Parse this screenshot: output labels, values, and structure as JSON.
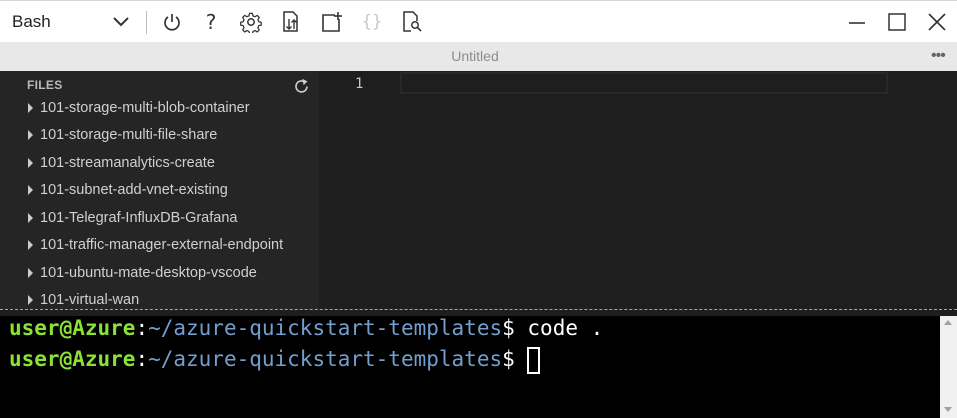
{
  "toolbar": {
    "shell_label": "Bash",
    "icons": [
      "power-icon",
      "help-icon",
      "settings-icon",
      "upload-download-icon",
      "new-session-icon",
      "web-preview-icon",
      "open-editor-icon"
    ],
    "help_glyph": "?",
    "braces_glyph": "{}"
  },
  "window": {
    "buttons": [
      "minimize-icon",
      "maximize-icon",
      "close-icon"
    ]
  },
  "editor": {
    "title": "Untitled",
    "more_glyph": "•••",
    "line_numbers": [
      "1"
    ]
  },
  "explorer": {
    "header": "FILES",
    "files": [
      "101-storage-multi-blob-container",
      "101-storage-multi-file-share",
      "101-streamanalytics-create",
      "101-subnet-add-vnet-existing",
      "101-Telegraf-InfluxDB-Grafana",
      "101-traffic-manager-external-endpoint",
      "101-ubuntu-mate-desktop-vscode",
      "101-virtual-wan"
    ]
  },
  "terminal": {
    "lines": [
      {
        "user": "user@Azure",
        "colon": ":",
        "path": "~/azure-quickstart-templates",
        "dollar": "$",
        "command": " code ."
      },
      {
        "user": "user@Azure",
        "colon": ":",
        "path": "~/azure-quickstart-templates",
        "dollar": "$",
        "command": " "
      }
    ]
  },
  "colors": {
    "prompt_user": "#8ae234",
    "prompt_path": "#729fcf",
    "explorer_bg": "#252526",
    "editor_bg": "#1e1e1e"
  }
}
